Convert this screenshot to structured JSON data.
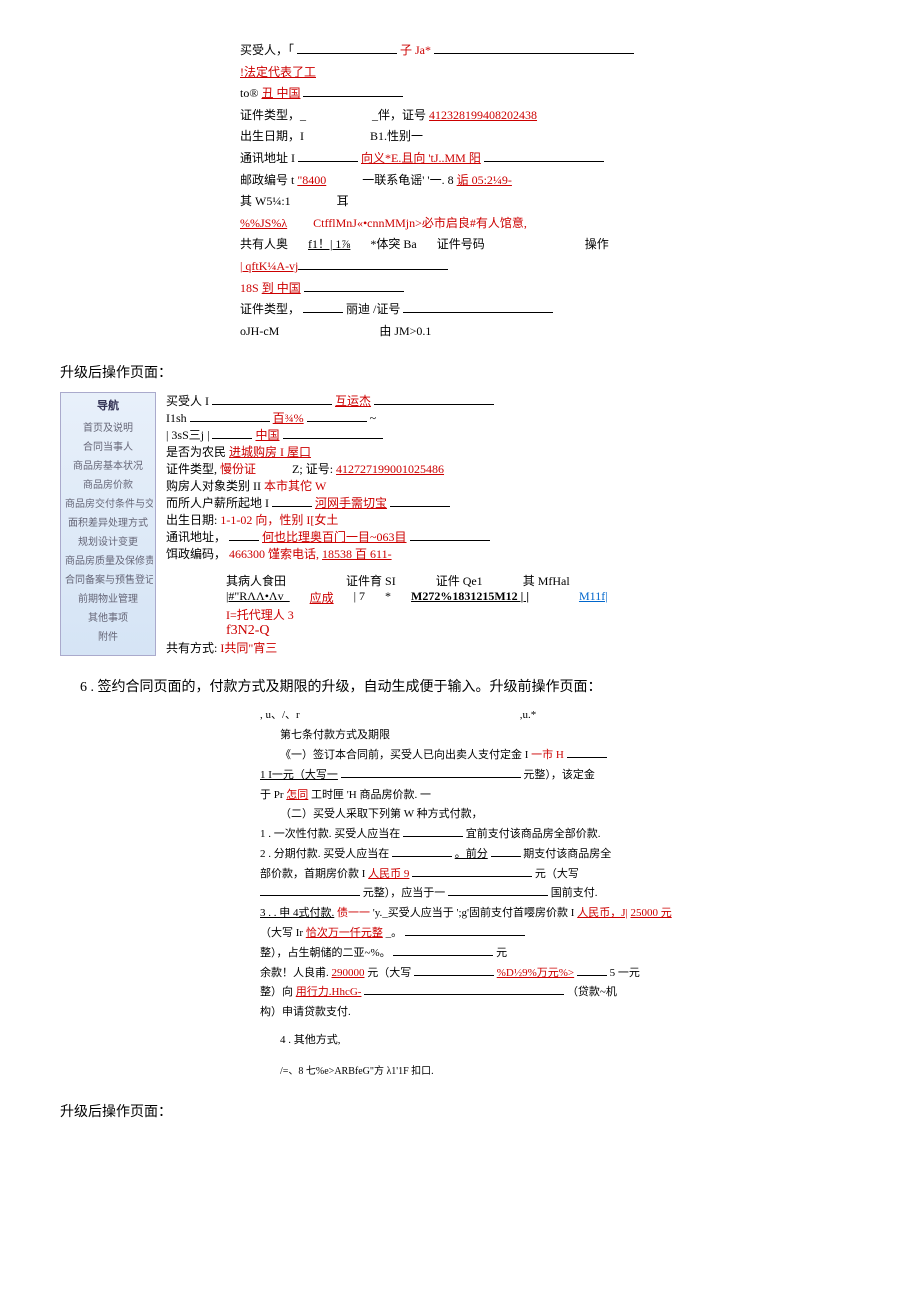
{
  "block1": {
    "l1a": "买受人，「",
    "l1b": "子 Ja*",
    "l2": "!法定代表了工",
    "l3a": "to®",
    "l3b": "丑 中国",
    "l4a": "证件类型，_",
    "l4b": "_伴，证号",
    "l4c": "412328199408202438",
    "l5a": "出生日期，I",
    "l5b": "B1.性别一",
    "l6a": "通讯地址 I",
    "l6b": "向义*E.且向 'tJ..MM 阳",
    "l7a": "邮政编号 t",
    "l7b": "\"8400",
    "l7c": "一联系龟谣'  '一. 8",
    "l7d": "诟 05:2¼9-",
    "l8a": "其 W5¼:1",
    "l8b": "耳",
    "l9a": "%%JS%λ",
    "l9b": "CtfflMnJ«•cnnMMjn>必市启良#有人馆意,",
    "l10a": "共有人奥",
    "l10b": "f1！| 1⅞",
    "l10c": "*体突 Ba",
    "l10d": "证件号码",
    "l10e": "操作",
    "l11": "| qftK¼A-vj",
    "l12a": "18S",
    "l12b": "到 中国",
    "l13a": "证件类型，",
    "l13b": "丽迪",
    "l13c": "/证号",
    "l14a": "oJH-cM",
    "l14b": "由 JM>0.1"
  },
  "sec1": "升级后操作页面：",
  "nav": {
    "title": "导航",
    "items": [
      "首页及说明",
      "合同当事人",
      "商品房基本状况",
      "商品房价款",
      "商品房交付条件与交付手续",
      "面积差异处理方式",
      "规划设计变更",
      "商品房质量及保修责任",
      "合同备案与预售登记",
      "前期物业管理",
      "其他事项",
      "附件"
    ]
  },
  "block2": {
    "l1a": "买受人 I",
    "l1b": "互运杰",
    "l2a": "I1sh",
    "l2b": "百¾%",
    "l2c": "~",
    "l3a": "| 3sS三j |",
    "l3b": "中国",
    "l4a": "是否为农民",
    "l4b": "进城购房 I 屋口",
    "l5a": "证件类型,",
    "l5b": "慢份证",
    "l5c": "Z;  证号:",
    "l5d": "412727199001025486",
    "l6a": "购房人对象类别 II",
    "l6b": "本市其佗 W",
    "l7a": "而所人户薪所起地 I",
    "l7b": "河网手需切宝",
    "l8a": "出生日期:",
    "l8b": "1-1-02 向，性别 I[女土",
    "l9a": "通讯地址，",
    "l9b": "何也比理奥百门一目~063目",
    "l10a": "饵政编码，",
    "l10b": "466300 馑索电话,",
    "l10c": "18538 百 611-",
    "th1": "其病人食田",
    "th2": "证件育 SI",
    "th3": "证件 Qe1",
    "th4": "其 MfHal",
    "r1a": "|#\"RΛΛ•Λv_",
    "r1b": "应成",
    "r1c": "| 7",
    "r1d": "*",
    "r1e": "M272%1831215M12 |  |",
    "r1f": "M11f|",
    "r2a": "I=托代理人 3",
    "r2b": "f3N2-Q",
    "l11a": "共有方式:",
    "l11b": "I共同\"宵三"
  },
  "item6": "6 . 签约合同页面的，付款方式及期限的升级，自动生成便于输入。升级前操作页面：",
  "block3": {
    "l0a": ", u、/、r",
    "l0b": ",u.*",
    "l1": "第七条付款方式及期限",
    "l2a": "《一）签订本合同前，买受人已向出卖人支付定金 I",
    "l2b": "一市 H",
    "l3a": "1 I一元（大写一",
    "l3b": "元整），该定金",
    "l4a": "于 Pr",
    "l4b": "怎同",
    "l4c": "工时匣 'H 商品房价款. 一",
    "l5": "（二）买受人采取下列第 W 种方式付款，",
    "l6a": "1  . 一次性付款. 买受人应当在",
    "l6b": "宜前支付该商品房全部价款.",
    "l7a": "2  . 分期付款. 买受人应当在",
    "l7b": "。前分",
    "l7c": "期支付该商品房全",
    "l8a": "部价款，首期房价款 I",
    "l8b": "人民币 9",
    "l8c": "元（大写",
    "l9a": "元整），应当于一",
    "l9b": "国前支付.",
    "l10a": "3  .  . 申 4式付款.",
    "l10b": "债一一",
    "l10c": "'y._买受人应当于 ';g'固前支付首嘤房价款 I",
    "l10d": "人民币，J|",
    "l10e": "25000 元",
    "l11a": "（大写  Ir",
    "l11b": "恰次万一仟元整",
    "l11c": "_。",
    "l12": "整），占生朝储的二亚~%。",
    "l12b": "元",
    "l13a": "余款！人良甫.",
    "l13b": "290000",
    "l13c": " 元（大写",
    "l13d": "%D½9%万元%>",
    "l13e": "5 一元",
    "l14a": "整）向",
    "l14b": "用行力.HhcG-",
    "l14c": "（贷款~机",
    "l15": "构）申请贷款支付.",
    "l16": "4   . 其他方式,",
    "l17": "/=、8 七%e>ARBfeG\"方 λ1'1F 扣口."
  },
  "sec2": "升级后操作页面："
}
